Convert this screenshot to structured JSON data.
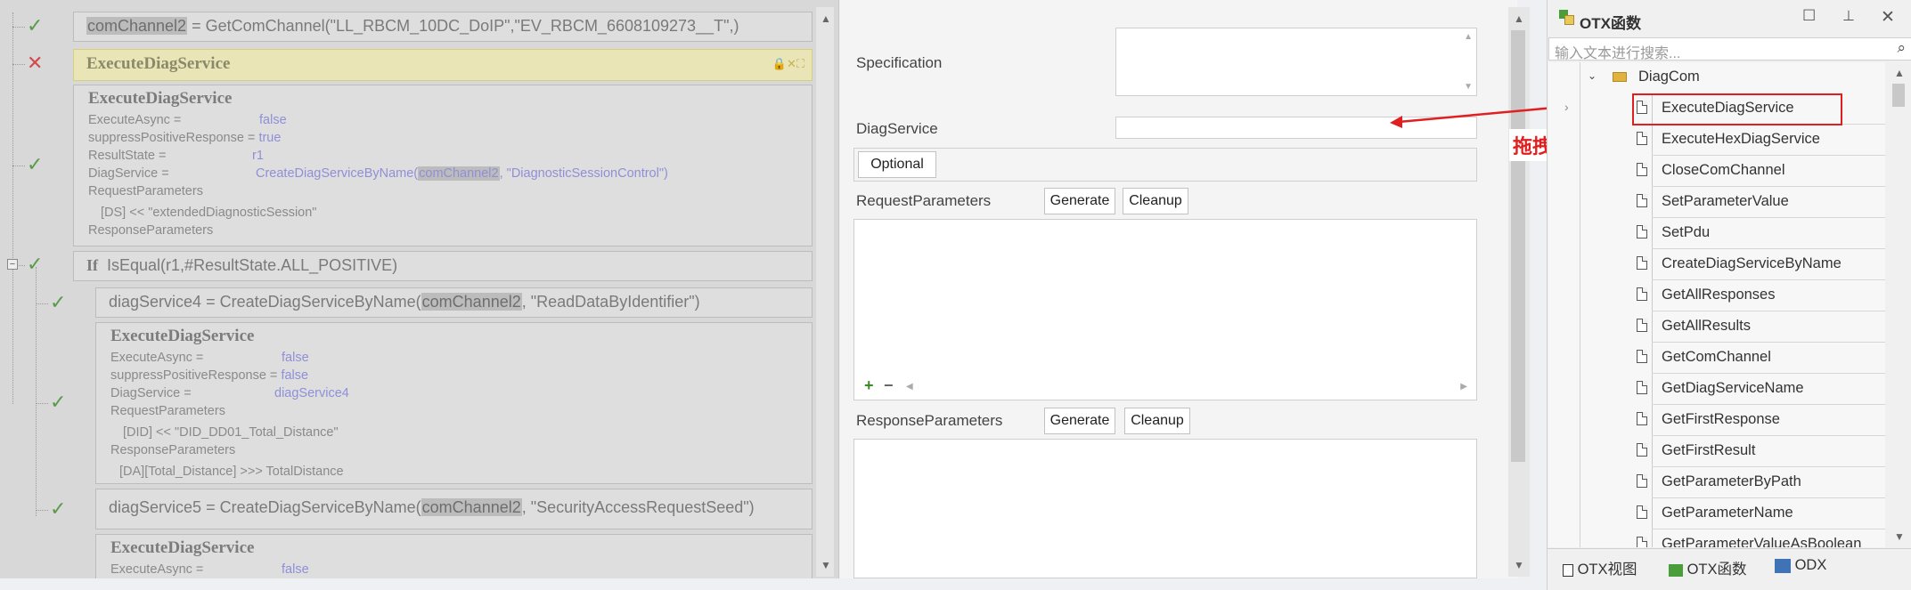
{
  "script": {
    "line1": {
      "var": "comChannel2",
      "rest": " = GetComChannel(\"LL_RBCM_10DC_DoIP\",\"EV_RBCM_6608109273__T\",)"
    },
    "selected_title": "ExecuteDiagService",
    "block1": {
      "title": "ExecuteDiagService",
      "k_async": "ExecuteAsync =",
      "v_async": "false",
      "k_suppress": "suppressPositiveResponse =",
      "v_suppress": "true",
      "k_result": "ResultState =",
      "v_result": "r1",
      "k_diag": "DiagService =",
      "v_diag_pre": "CreateDiagServiceByName(",
      "v_diag_hl": "comChannel2",
      "v_diag_post": ", \"DiagnosticSessionControl\")",
      "req": "RequestParameters",
      "req_item": "[DS] << \"extendedDiagnosticSession\"",
      "resp": "ResponseParameters"
    },
    "if_line": {
      "kw": "If",
      "rest": "IsEqual(r1,#ResultState.ALL_POSITIVE)"
    },
    "line_ds4": {
      "pre": "diagService4 = CreateDiagServiceByName(",
      "hl": "comChannel2",
      "post": ", \"ReadDataByIdentifier\")"
    },
    "block2": {
      "title": "ExecuteDiagService",
      "k_async": "ExecuteAsync =",
      "v_async": "false",
      "k_suppress": "suppressPositiveResponse =",
      "v_suppress": "false",
      "k_diag": "DiagService =",
      "v_diag": "diagService4",
      "req": "RequestParameters",
      "req_item": "[DID] << \"DID_DD01_Total_Distance\"",
      "resp": "ResponseParameters",
      "resp_item": "[DA][Total_Distance] >>> TotalDistance"
    },
    "line_ds5": {
      "pre": "diagService5 = CreateDiagServiceByName(",
      "hl": "comChannel2",
      "post": ", \"SecurityAccessRequestSeed\")"
    },
    "block3": {
      "title": "ExecuteDiagService",
      "k_async": "ExecuteAsync =",
      "v_async": "false"
    }
  },
  "props": {
    "specification_label": "Specification",
    "diagservice_label": "DiagService",
    "optional_label": "Optional",
    "request_label": "RequestParameters",
    "response_label": "ResponseParameters",
    "generate_label": "Generate",
    "cleanup_label": "Cleanup",
    "plus": "+",
    "minus": "−"
  },
  "annotation": {
    "drag_label": "拖拽",
    "color": "#e02020"
  },
  "otx": {
    "title": "OTX函数",
    "search_placeholder": "输入文本进行搜索...",
    "folder": "DiagCom",
    "items": [
      "ExecuteDiagService",
      "ExecuteHexDiagService",
      "CloseComChannel",
      "SetParameterValue",
      "SetPdu",
      "CreateDiagServiceByName",
      "GetAllResponses",
      "GetAllResults",
      "GetComChannel",
      "GetDiagServiceName",
      "GetFirstResponse",
      "GetFirstResult",
      "GetParameterByPath",
      "GetParameterName",
      "GetParameterValueAsBoolean"
    ],
    "tabs": [
      "OTX视图",
      "OTX函数",
      "ODX"
    ]
  }
}
